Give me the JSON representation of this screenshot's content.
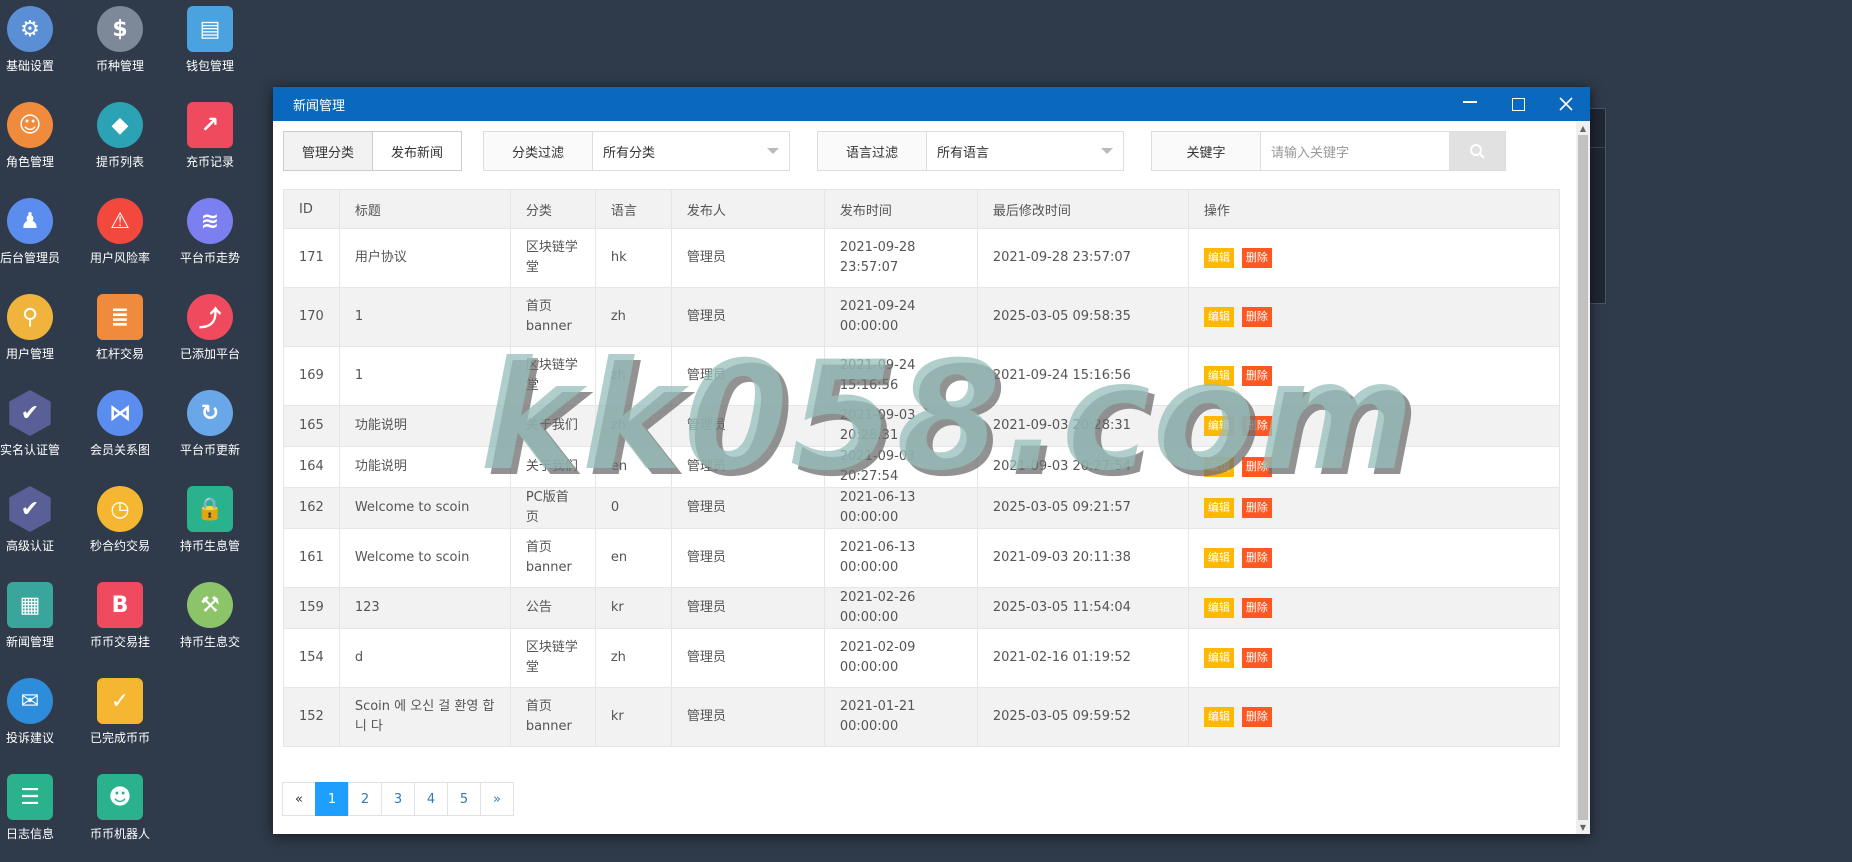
{
  "desktop": {
    "icons": [
      {
        "label": "基础设置",
        "icon": "gear-icon",
        "color": "#5a8fd6"
      },
      {
        "label": "币种管理",
        "icon": "dollar-icon",
        "color": "#7d8899"
      },
      {
        "label": "钱包管理",
        "icon": "wallet-icon",
        "color": "#4aa3df"
      },
      {
        "label": "角色管理",
        "icon": "users-icon",
        "color": "#f08a3c"
      },
      {
        "label": "提币列表",
        "icon": "coin-icon",
        "color": "#2ba3b5"
      },
      {
        "label": "充币记录",
        "icon": "chart-icon",
        "color": "#f04a5e"
      },
      {
        "label": "后台管理员",
        "icon": "admin-icon",
        "color": "#5b8def"
      },
      {
        "label": "用户风险率",
        "icon": "alarm-icon",
        "color": "#f2483d"
      },
      {
        "label": "平台币走势",
        "icon": "layers-icon",
        "color": "#7b7ff0"
      },
      {
        "label": "用户管理",
        "icon": "user-search-icon",
        "color": "#f0b43c"
      },
      {
        "label": "杠杆交易",
        "icon": "stack-icon",
        "color": "#f08a3c"
      },
      {
        "label": "已添加平台",
        "icon": "trend-icon",
        "color": "#f04a5e"
      },
      {
        "label": "实名认证管",
        "icon": "verify-icon",
        "color": "#5b5f97"
      },
      {
        "label": "会员关系图",
        "icon": "network-icon",
        "color": "#5b8def"
      },
      {
        "label": "平台币更新",
        "icon": "cloud-refresh-icon",
        "color": "#6aa7e8"
      },
      {
        "label": "高级认证",
        "icon": "verify-advanced-icon",
        "color": "#5b5f97"
      },
      {
        "label": "秒合约交易",
        "icon": "timer-icon",
        "color": "#f5b731"
      },
      {
        "label": "持币生息管",
        "icon": "lock-icon",
        "color": "#29b28c"
      },
      {
        "label": "新闻管理",
        "icon": "news-icon",
        "color": "#3aa69b"
      },
      {
        "label": "币币交易挂",
        "icon": "bitcoin-icon",
        "color": "#f04a5e"
      },
      {
        "label": "持币生息交",
        "icon": "hammer-icon",
        "color": "#8cc46a"
      },
      {
        "label": "投诉建议",
        "icon": "mail-icon",
        "color": "#2d8ddb"
      },
      {
        "label": "已完成币币",
        "icon": "check-icon",
        "color": "#f5b731"
      },
      {
        "label": "日志信息",
        "icon": "log-icon",
        "color": "#29b28c"
      },
      {
        "label": "币币机器人",
        "icon": "robot-icon",
        "color": "#29b28c"
      }
    ]
  },
  "window": {
    "title": "新闻管理"
  },
  "toolbar": {
    "tab_category": "管理分类",
    "tab_publish": "发布新闻",
    "category_filter_label": "分类过滤",
    "category_filter_value": "所有分类",
    "language_filter_label": "语言过滤",
    "language_filter_value": "所有语言",
    "keyword_label": "关键字",
    "keyword_placeholder": "请输入关键字"
  },
  "table": {
    "headers": [
      "ID",
      "标题",
      "分类",
      "语言",
      "发布人",
      "发布时间",
      "最后修改时间",
      "操作"
    ],
    "edit_label": "编辑",
    "delete_label": "删除",
    "rows": [
      {
        "id": "171",
        "title": "用户协议",
        "category": "区块链学堂",
        "lang": "hk",
        "author": "管理员",
        "published": "2021-09-28 23:57:07",
        "modified": "2021-09-28 23:57:07"
      },
      {
        "id": "170",
        "title": "1",
        "category": "首页banner",
        "lang": "zh",
        "author": "管理员",
        "published": "2021-09-24 00:00:00",
        "modified": "2025-03-05 09:58:35"
      },
      {
        "id": "169",
        "title": "1",
        "category": "区块链学堂",
        "lang": "zh",
        "author": "管理员",
        "published": "2021-09-24 15:16:56",
        "modified": "2021-09-24 15:16:56"
      },
      {
        "id": "165",
        "title": "功能说明",
        "category": "关于我们",
        "lang": "zh",
        "author": "管理员",
        "published": "2021-09-03 20:28:31",
        "modified": "2021-09-03 20:28:31"
      },
      {
        "id": "164",
        "title": "功能说明",
        "category": "关于我们",
        "lang": "en",
        "author": "管理员",
        "published": "2021-09-03 20:27:54",
        "modified": "2021-09-03 20:27:54"
      },
      {
        "id": "162",
        "title": "Welcome to scoin",
        "category": "PC版首页",
        "lang": "0",
        "author": "管理员",
        "published": "2021-06-13 00:00:00",
        "modified": "2025-03-05 09:21:57"
      },
      {
        "id": "161",
        "title": "Welcome to scoin",
        "category": "首页banner",
        "lang": "en",
        "author": "管理员",
        "published": "2021-06-13 00:00:00",
        "modified": "2021-09-03 20:11:38"
      },
      {
        "id": "159",
        "title": "123",
        "category": "公告",
        "lang": "kr",
        "author": "管理员",
        "published": "2021-02-26 00:00:00",
        "modified": "2025-03-05 11:54:04"
      },
      {
        "id": "154",
        "title": "d",
        "category": "区块链学堂",
        "lang": "zh",
        "author": "管理员",
        "published": "2021-02-09 00:00:00",
        "modified": "2021-02-16 01:19:52"
      },
      {
        "id": "152",
        "title": "Scoin 에 오신 걸 환영 합니 다",
        "category": "首页banner",
        "lang": "kr",
        "author": "管理员",
        "published": "2021-01-21 00:00:00",
        "modified": "2025-03-05 09:59:52"
      }
    ]
  },
  "pagination": {
    "prev": "«",
    "pages": [
      "1",
      "2",
      "3",
      "4",
      "5"
    ],
    "current": "1",
    "next": "»"
  },
  "watermark": "kk058.com"
}
